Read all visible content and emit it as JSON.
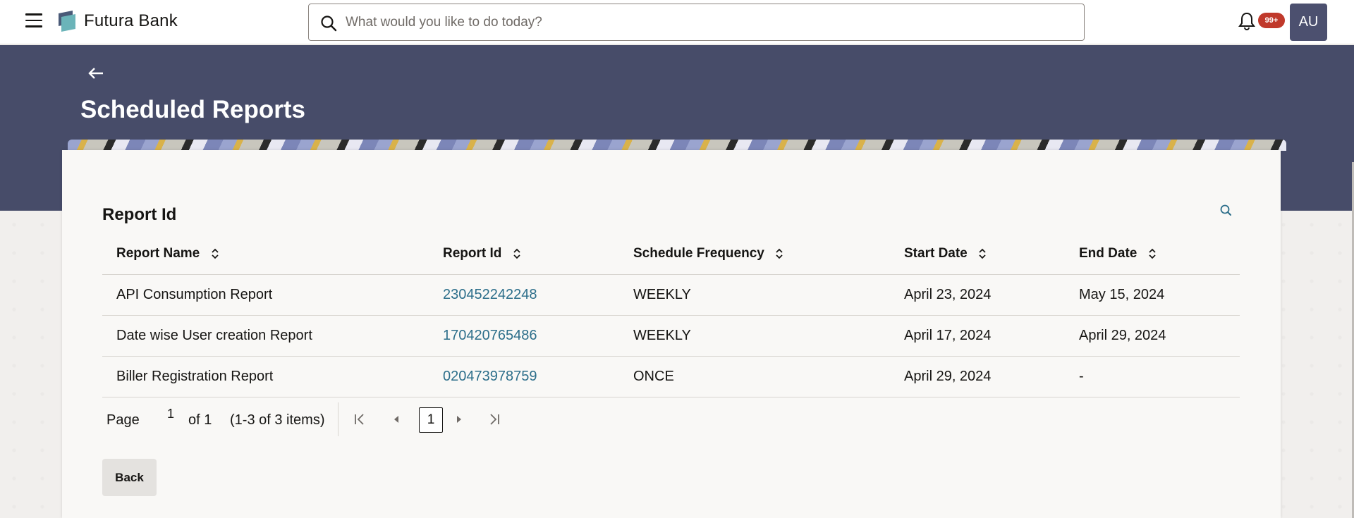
{
  "header": {
    "brand": "Futura Bank",
    "search_placeholder": "What would you like to do today?",
    "notification_count": "99+",
    "avatar_initials": "AU"
  },
  "page": {
    "title": "Scheduled Reports"
  },
  "card": {
    "title": "Report Id"
  },
  "table": {
    "columns": [
      "Report Name",
      "Report Id",
      "Schedule Frequency",
      "Start Date",
      "End Date"
    ],
    "rows": [
      [
        "API Consumption Report",
        "230452242248",
        "WEEKLY",
        "April 23, 2024",
        "May 15, 2024"
      ],
      [
        "Date wise User creation Report",
        "170420765486",
        "WEEKLY",
        "April 17, 2024",
        "April 29, 2024"
      ],
      [
        "Biller Registration Report",
        "020473978759",
        "ONCE",
        "April 29, 2024",
        "-"
      ]
    ]
  },
  "pagination": {
    "page_label": "Page",
    "page_value": "1",
    "of_label": "of 1",
    "items_label": "(1-3 of 3 items)",
    "current_page": "1"
  },
  "actions": {
    "back_label": "Back"
  },
  "colors": {
    "banner": "#474c69",
    "link": "#2c6e8a",
    "badge": "#c0392b",
    "avatar": "#4c506f"
  },
  "icons": {
    "menu": "hamburger-icon",
    "search": "search-icon",
    "bell": "bell-icon",
    "back": "arrow-left-icon",
    "sort": "sort-icon",
    "first": "first-page-icon",
    "prev": "prev-page-icon",
    "next": "next-page-icon",
    "last": "last-page-icon"
  }
}
